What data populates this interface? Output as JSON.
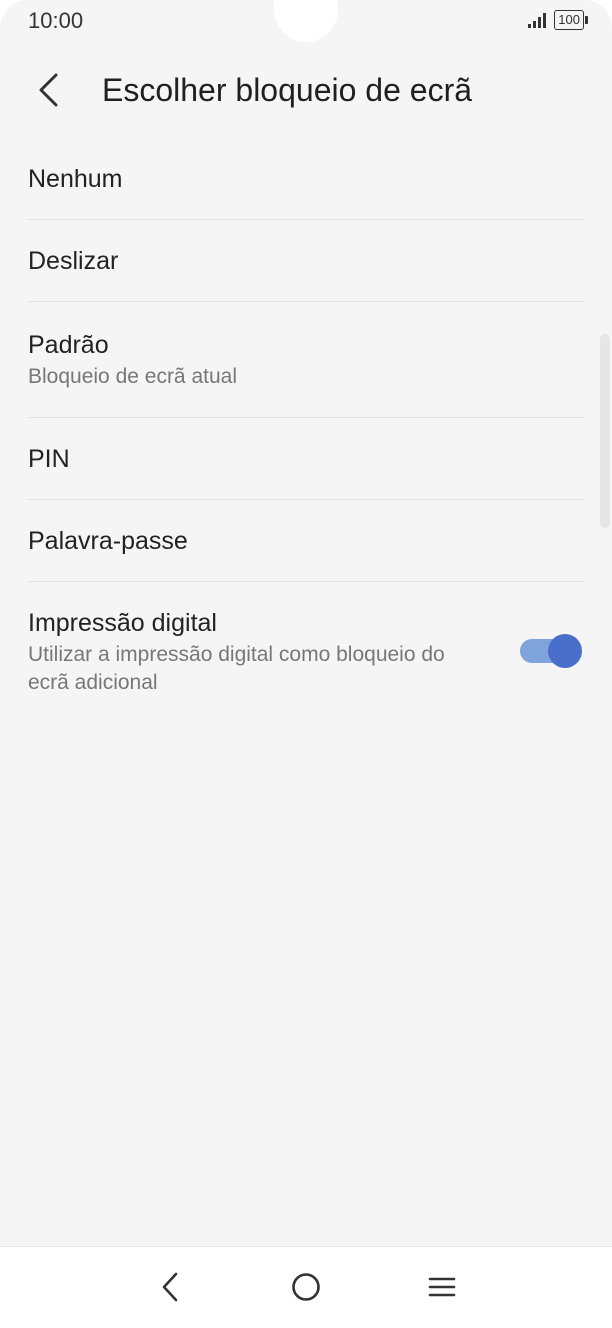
{
  "status_bar": {
    "time": "10:00",
    "battery": "100",
    "icons": [
      "signal-icon",
      "battery-icon"
    ]
  },
  "header": {
    "title": "Escolher bloqueio de ecrã",
    "back_icon": "chevron-left-icon"
  },
  "options": [
    {
      "title": "Nenhum",
      "subtitle": ""
    },
    {
      "title": "Deslizar",
      "subtitle": ""
    },
    {
      "title": "Padrão",
      "subtitle": "Bloqueio de ecrã atual"
    },
    {
      "title": "PIN",
      "subtitle": ""
    },
    {
      "title": "Palavra-passe",
      "subtitle": ""
    },
    {
      "title": "Impressão digital",
      "subtitle": "Utilizar a impressão digital como bloqueio do ecrã adicional",
      "toggle_on": true
    }
  ],
  "colors": {
    "background": "#f5f5f5",
    "accent": "#4a6fcb",
    "accent_track": "#7fa3db",
    "text_primary": "#222222",
    "text_secondary": "#777777"
  },
  "nav_bar": {
    "icons": [
      "back-icon",
      "home-icon",
      "recents-menu-icon"
    ]
  }
}
